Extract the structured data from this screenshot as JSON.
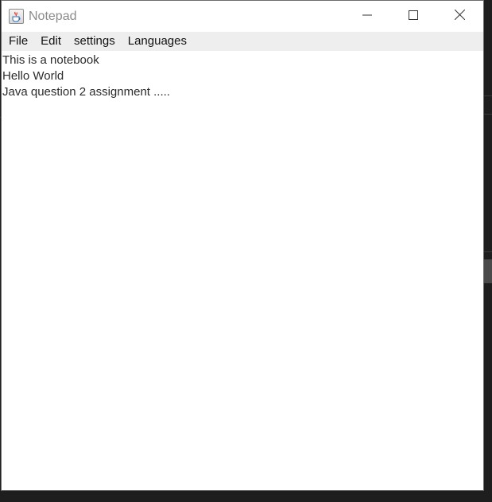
{
  "window": {
    "title": "Notepad",
    "app_icon": "java-cup-icon",
    "controls": {
      "minimize_icon": "minimize-icon",
      "maximize_icon": "maximize-icon",
      "close_icon": "close-icon"
    }
  },
  "menubar": {
    "items": [
      {
        "label": "File"
      },
      {
        "label": "Edit"
      },
      {
        "label": "settings"
      },
      {
        "label": "Languages"
      }
    ]
  },
  "editor": {
    "lines": [
      "This is a notebook",
      "Hello World",
      "Java question 2 assignment ....."
    ]
  },
  "colors": {
    "titlebar_bg": "#ffffff",
    "menubar_bg": "#eeeeee",
    "title_text": "#8c8c8c",
    "desktop_bg": "#1e1e1e"
  }
}
